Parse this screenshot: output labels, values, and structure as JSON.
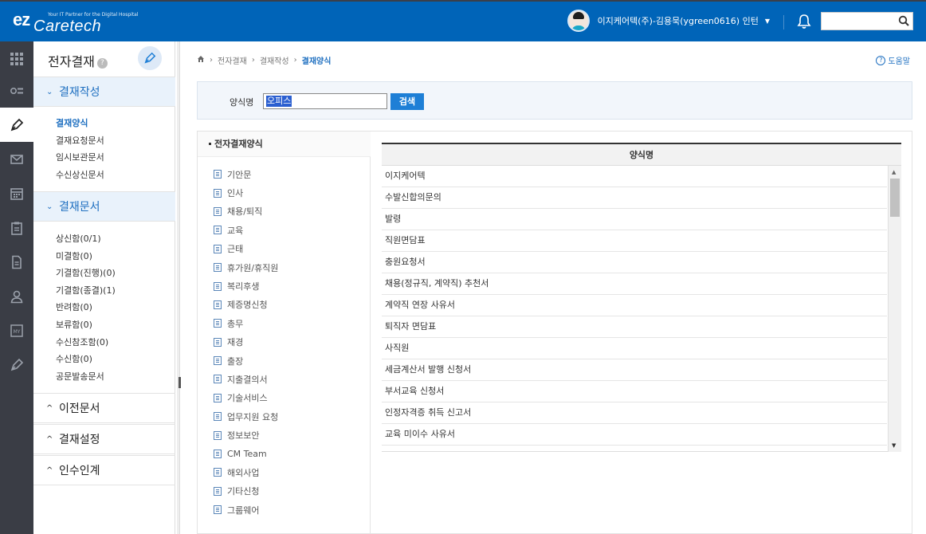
{
  "header": {
    "logo_ez": "ez",
    "logo_brand": "Caretech",
    "logo_tagline": "Your IT Partner for the Digital Hospital",
    "user_name": "이지케어텍(주)-김용묵(ygreen0616) 인턴",
    "search_placeholder": ""
  },
  "sidebar": {
    "title": "전자결재",
    "help": "?",
    "sections": [
      {
        "label": "결재작성",
        "open": true,
        "items": [
          "결재양식",
          "결재요청문서",
          "임시보관문서",
          "수신상신문서"
        ]
      },
      {
        "label": "결재문서",
        "open": true,
        "items": [
          "상신함(0/1)",
          "미결함(0)",
          "기결함(진행)(0)",
          "기결함(종결)(1)",
          "반려함(0)",
          "보류함(0)",
          "수신참조함(0)",
          "수신함(0)",
          "공문발송문서"
        ]
      },
      {
        "label": "이전문서",
        "open": false
      },
      {
        "label": "결재설정",
        "open": false
      },
      {
        "label": "인수인계",
        "open": false
      }
    ]
  },
  "breadcrumb": {
    "items": [
      "전자결재",
      "결재작성"
    ],
    "current": "결재양식"
  },
  "help_label": "도움말",
  "search": {
    "label": "양식명",
    "value": "오피스",
    "button": "검색"
  },
  "tree": {
    "title": "전자결재양식",
    "items": [
      "기안문",
      "인사",
      "채용/퇴직",
      "교육",
      "근태",
      "휴가원/휴직원",
      "복리후생",
      "제증명신청",
      "총무",
      "재경",
      "출장",
      "지출결의서",
      "기술서비스",
      "업무지원 요청",
      "정보보안",
      "CM Team",
      "해외사업",
      "기타신청",
      "그룹웨어"
    ]
  },
  "grid": {
    "column": "양식명",
    "rows": [
      "이지케어텍",
      "수발신합의문의",
      "발령",
      "직원면담표",
      "충원요청서",
      "채용(정규직, 계약직) 추천서",
      "계약직 연장 사유서",
      "퇴직자 면담표",
      "사직원",
      "세금계산서 발행 신청서",
      "부서교육 신청서",
      "인정자격증 취득 신고서",
      "교육 미이수 사유서"
    ]
  },
  "colors": {
    "header_bg": "#0064b8",
    "accent": "#1e6fc0",
    "rail_bg": "#3a3d45"
  }
}
